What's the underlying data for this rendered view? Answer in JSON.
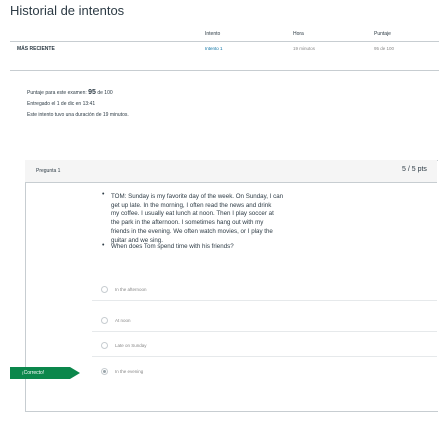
{
  "page": {
    "title": "Historial de intentos"
  },
  "table": {
    "headers": {
      "attempt": "Intento",
      "time": "Hora",
      "score": "Puntaje"
    },
    "row": {
      "label": "MÁS RECIENTE",
      "attempt": "Intento 1",
      "time": "19 minutos",
      "score": "95 de 100"
    }
  },
  "summary": {
    "score_prefix": "Puntaje para este examen:",
    "score_value": "95",
    "score_suffix": "de 100",
    "submitted": "Entregado el 1 de dic en 13:41",
    "duration": "Este intento tuvo una duración de 19 minutos."
  },
  "question": {
    "name": "Pregunta 1",
    "points": "5 / 5 pts",
    "passage_lines": [
      "TOM: Sunday is my favorite day of the week. On Sunday, I can",
      "get up late. In the morning, I often read the news and drink",
      "my coffee. I usually eat lunch at noon. Then I play soccer at",
      "the park in the afternoon. I sometimes hang out with my",
      "friends in the evening. We often watch movies, or I play the",
      "guitar and we sing."
    ],
    "prompt": "When does Tom spend time with his friends?",
    "answers": [
      "In the afternoon",
      "At noon",
      "Late on Sunday",
      "In the evening"
    ],
    "selected_index": 3,
    "correct_label": "¡Correcto!"
  },
  "colors": {
    "correct": "#0b874b",
    "link": "#0770a3",
    "border": "#c7cdd1"
  }
}
